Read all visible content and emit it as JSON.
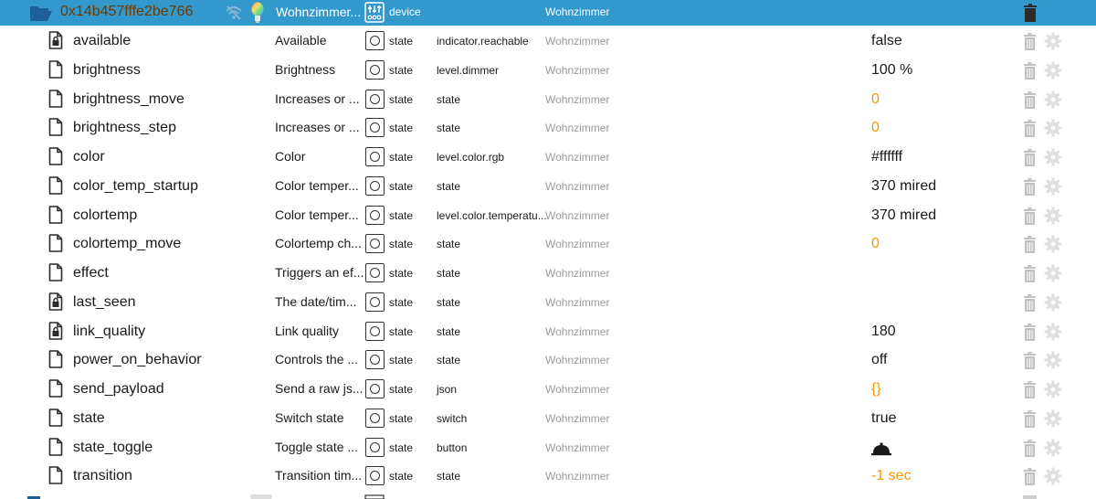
{
  "header": {
    "device_id": "0x14b457fffe2be766",
    "name": "Wohnzimmer...",
    "role": "device",
    "room": "Wohnzimmer"
  },
  "colors": {
    "header_bg": "#3399cc",
    "device_id_text": "#6b3a00",
    "number_value": "#f09a00",
    "room_text": "#9a9a9a"
  },
  "rows": [
    {
      "name": "available",
      "locked": true,
      "description": "Available",
      "type": "state",
      "role": "indicator.reachable",
      "room": "Wohnzimmer",
      "value": "false",
      "value_orange": false,
      "value_kind": "text"
    },
    {
      "name": "brightness",
      "locked": false,
      "description": "Brightness",
      "type": "state",
      "role": "level.dimmer",
      "room": "Wohnzimmer",
      "value": "100 %",
      "value_orange": false,
      "value_kind": "text"
    },
    {
      "name": "brightness_move",
      "locked": false,
      "description": "Increases or ...",
      "type": "state",
      "role": "state",
      "room": "Wohnzimmer",
      "value": "0",
      "value_orange": true,
      "value_kind": "text"
    },
    {
      "name": "brightness_step",
      "locked": false,
      "description": "Increases or ...",
      "type": "state",
      "role": "state",
      "room": "Wohnzimmer",
      "value": "0",
      "value_orange": true,
      "value_kind": "text"
    },
    {
      "name": "color",
      "locked": false,
      "description": "Color",
      "type": "state",
      "role": "level.color.rgb",
      "room": "Wohnzimmer",
      "value": "#ffffff",
      "value_orange": false,
      "value_kind": "text"
    },
    {
      "name": "color_temp_startup",
      "locked": false,
      "description": "Color temper...",
      "type": "state",
      "role": "state",
      "room": "Wohnzimmer",
      "value": "370 mired",
      "value_orange": false,
      "value_kind": "text"
    },
    {
      "name": "colortemp",
      "locked": false,
      "description": "Color temper...",
      "type": "state",
      "role": "level.color.temperatu...",
      "room": "Wohnzimmer",
      "value": "370 mired",
      "value_orange": false,
      "value_kind": "text"
    },
    {
      "name": "colortemp_move",
      "locked": false,
      "description": "Colortemp ch...",
      "type": "state",
      "role": "state",
      "room": "Wohnzimmer",
      "value": "0",
      "value_orange": true,
      "value_kind": "text"
    },
    {
      "name": "effect",
      "locked": false,
      "description": "Triggers an ef...",
      "type": "state",
      "role": "state",
      "room": "Wohnzimmer",
      "value": "",
      "value_orange": false,
      "value_kind": "text"
    },
    {
      "name": "last_seen",
      "locked": true,
      "description": "The date/tim...",
      "type": "state",
      "role": "state",
      "room": "Wohnzimmer",
      "value": "",
      "value_orange": false,
      "value_kind": "text"
    },
    {
      "name": "link_quality",
      "locked": true,
      "description": "Link quality",
      "type": "state",
      "role": "state",
      "room": "Wohnzimmer",
      "value": "180",
      "value_orange": false,
      "value_kind": "text"
    },
    {
      "name": "power_on_behavior",
      "locked": false,
      "description": "Controls the ...",
      "type": "state",
      "role": "state",
      "room": "Wohnzimmer",
      "value": "off",
      "value_orange": false,
      "value_kind": "text"
    },
    {
      "name": "send_payload",
      "locked": false,
      "description": "Send a raw js...",
      "type": "state",
      "role": "json",
      "room": "Wohnzimmer",
      "value": "{}",
      "value_orange": true,
      "value_kind": "text"
    },
    {
      "name": "state",
      "locked": false,
      "description": "Switch state",
      "type": "state",
      "role": "switch",
      "room": "Wohnzimmer",
      "value": "true",
      "value_orange": false,
      "value_kind": "text"
    },
    {
      "name": "state_toggle",
      "locked": false,
      "description": "Toggle state ...",
      "type": "state",
      "role": "button",
      "room": "Wohnzimmer",
      "value": "",
      "value_orange": false,
      "value_kind": "bell-icon"
    },
    {
      "name": "transition",
      "locked": false,
      "description": "Transition tim...",
      "type": "state",
      "role": "state",
      "room": "Wohnzimmer",
      "value": "-1 sec",
      "value_orange": true,
      "value_kind": "text"
    }
  ]
}
